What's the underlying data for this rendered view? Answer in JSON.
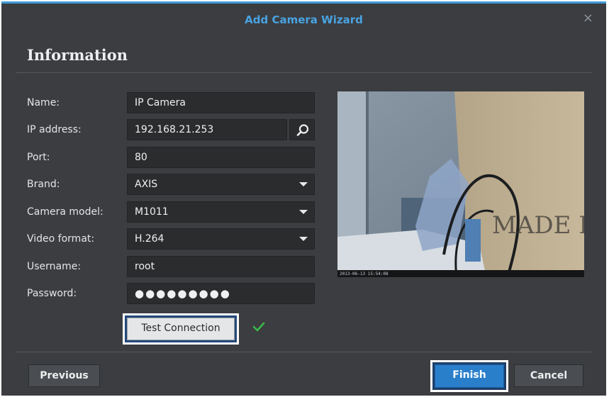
{
  "window": {
    "title": "Add Camera Wizard",
    "close_glyph": "×",
    "accent_color": "#3e9bd6"
  },
  "section": {
    "title": "Information"
  },
  "form": {
    "name": {
      "label": "Name:",
      "value": "IP Camera"
    },
    "ip": {
      "label": "IP address:",
      "value": "192.168.21.253",
      "search_icon": "search-icon"
    },
    "port": {
      "label": "Port:",
      "value": "80"
    },
    "brand": {
      "label": "Brand:",
      "value": "AXIS"
    },
    "model": {
      "label": "Camera model:",
      "value": "M1011"
    },
    "video_format": {
      "label": "Video format:",
      "value": "H.264"
    },
    "username": {
      "label": "Username:",
      "value": "root"
    },
    "password": {
      "label": "Password:",
      "value": "●●●●●●●●●"
    }
  },
  "test_connection": {
    "label": "Test Connection",
    "status_icon": "checkmark-icon",
    "status_color": "#3cb64b"
  },
  "preview": {
    "timestamp": "2013-06-13 15:54:08"
  },
  "footer": {
    "previous_label": "Previous",
    "finish_label": "Finish",
    "cancel_label": "Cancel",
    "finish_color": "#2a7fcb"
  }
}
